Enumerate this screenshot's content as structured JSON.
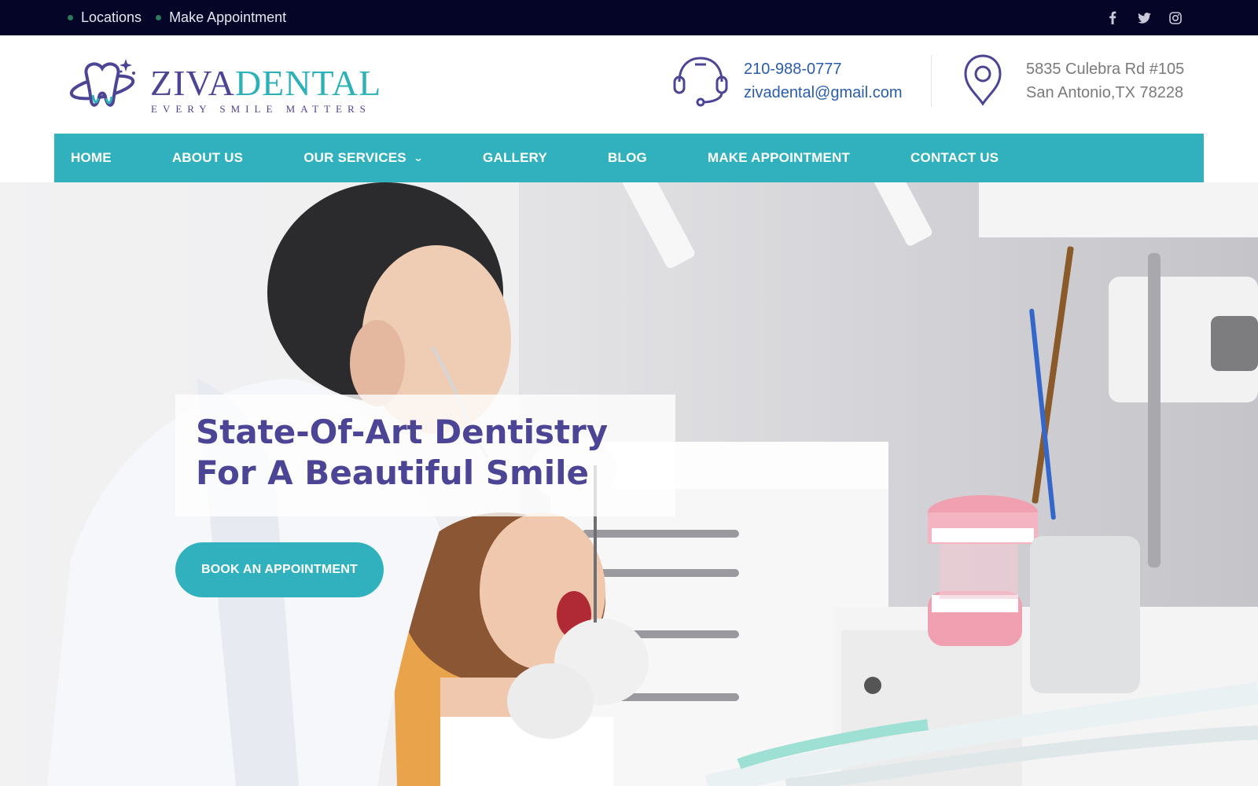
{
  "topbar": {
    "links": [
      {
        "label": "Locations"
      },
      {
        "label": "Make Appointment"
      }
    ],
    "social": [
      "facebook-icon",
      "twitter-icon",
      "instagram-icon"
    ]
  },
  "header": {
    "logo": {
      "brand_part1": "ZIVA",
      "brand_part2": "DENTAL",
      "tagline": "EVERY SMILE MATTERS"
    },
    "phone": "210-988-0777",
    "email": "zivadental@gmail.com",
    "address_line1": "5835 Culebra Rd #105",
    "address_line2": "San Antonio,TX 78228"
  },
  "nav": {
    "items": [
      {
        "label": "HOME"
      },
      {
        "label": "ABOUT US"
      },
      {
        "label": "OUR SERVICES"
      },
      {
        "label": "GALLERY"
      },
      {
        "label": "BLOG"
      },
      {
        "label": "MAKE APPOINTMENT"
      },
      {
        "label": "CONTACT US"
      }
    ]
  },
  "hero": {
    "headline": "State-Of-Art Dentistry For A Beautiful Smile",
    "cta_label": "BOOK AN APPOINTMENT"
  },
  "colors": {
    "topbar": "#050527",
    "brand_purple": "#4c4494",
    "brand_teal": "#31b1be",
    "link_blue": "#2a5caa"
  }
}
